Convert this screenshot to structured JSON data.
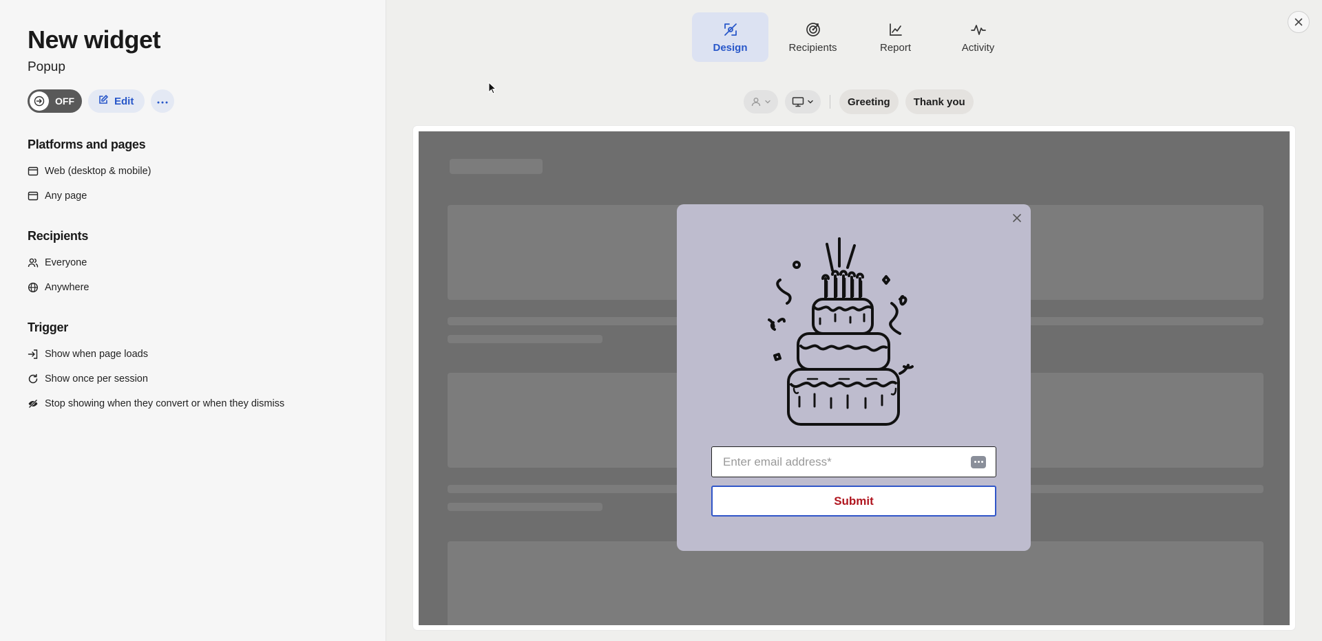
{
  "widget": {
    "title": "New widget",
    "subtitle": "Popup"
  },
  "controls": {
    "toggle_label": "OFF",
    "edit_label": "Edit"
  },
  "platforms": {
    "title": "Platforms and pages",
    "items": [
      {
        "icon": "browser-window-icon",
        "label": "Web (desktop & mobile)"
      },
      {
        "icon": "page-icon",
        "label": "Any page"
      }
    ]
  },
  "recipients": {
    "title": "Recipients",
    "items": [
      {
        "icon": "users-icon",
        "label": "Everyone"
      },
      {
        "icon": "globe-icon",
        "label": "Anywhere"
      }
    ]
  },
  "trigger": {
    "title": "Trigger",
    "items": [
      {
        "icon": "login-arrow-icon",
        "label": "Show when page loads"
      },
      {
        "icon": "refresh-icon",
        "label": "Show once per session"
      },
      {
        "icon": "eye-off-icon",
        "label": "Stop showing when they convert or when they dismiss"
      }
    ]
  },
  "tabs": [
    {
      "label": "Design",
      "icon": "pen-tool-icon",
      "active": true
    },
    {
      "label": "Recipients",
      "icon": "target-icon",
      "active": false
    },
    {
      "label": "Report",
      "icon": "line-chart-icon",
      "active": false
    },
    {
      "label": "Activity",
      "icon": "pulse-icon",
      "active": false
    }
  ],
  "toolbar": {
    "steps": [
      "Greeting",
      "Thank you"
    ]
  },
  "popup": {
    "email_placeholder": "Enter email address*",
    "submit_label": "Submit"
  },
  "colors": {
    "accent": "#2857c9",
    "tab_active_bg": "#dce2f2",
    "popup_bg": "#bebcce",
    "submit_text": "#b0161f",
    "overlay": "#6e6e6e"
  }
}
